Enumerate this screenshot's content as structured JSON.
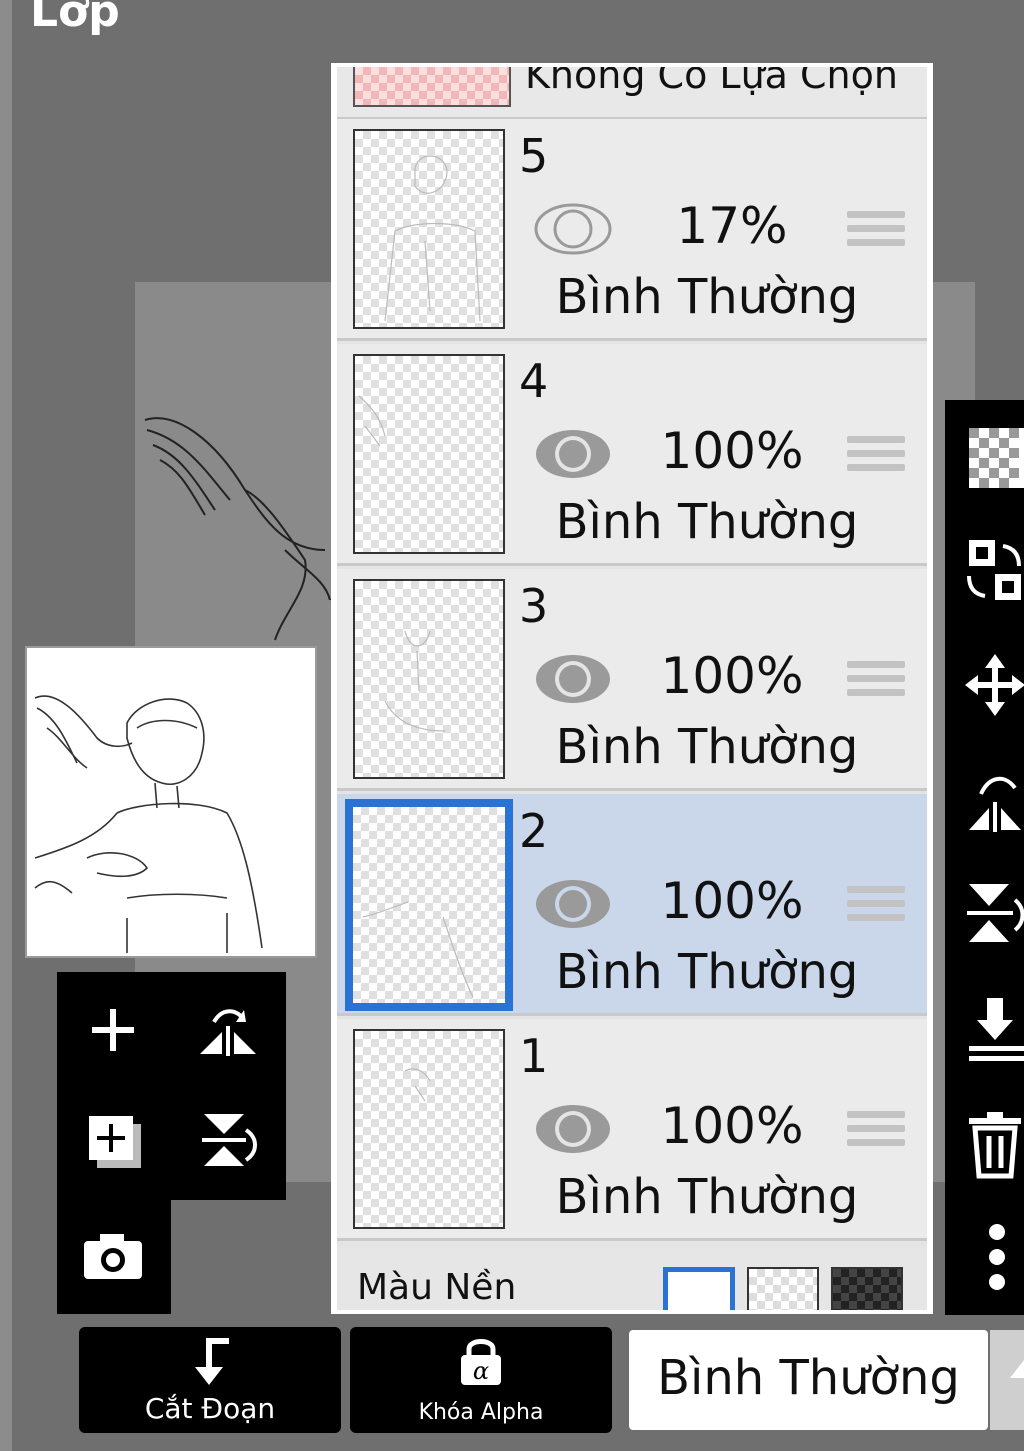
{
  "header": {
    "title": "Lớp"
  },
  "layers_panel": {
    "no_selection_label": "Không Có Lựa Chọn",
    "layers": [
      {
        "number": "5",
        "opacity": "17%",
        "blend_mode": "Bình Thường",
        "selected": false,
        "visible": true
      },
      {
        "number": "4",
        "opacity": "100%",
        "blend_mode": "Bình Thường",
        "selected": false,
        "visible": true
      },
      {
        "number": "3",
        "opacity": "100%",
        "blend_mode": "Bình Thường",
        "selected": false,
        "visible": true
      },
      {
        "number": "2",
        "opacity": "100%",
        "blend_mode": "Bình Thường",
        "selected": true,
        "visible": true
      },
      {
        "number": "1",
        "opacity": "100%",
        "blend_mode": "Bình Thường",
        "selected": false,
        "visible": true
      }
    ],
    "background_label": "Màu Nền"
  },
  "bottom_bar": {
    "clip_label": "Cắt Đoạn",
    "alpha_lock_label": "Khóa Alpha",
    "blend_mode_value": "Bình Thường"
  },
  "colors": {
    "selection_highlight": "#cad7ea",
    "selected_border": "#2a72d4",
    "app_background": "#6f6f6f"
  },
  "icons": {
    "left_tools": [
      "add-layer-icon",
      "flip-horizontal-icon",
      "duplicate-layer-icon",
      "flip-vertical-icon",
      "camera-icon"
    ],
    "right_tools": [
      "transparency-icon",
      "swap-layers-icon",
      "move-icon",
      "flip-horizontal-icon",
      "flip-vertical-icon",
      "merge-down-icon",
      "trash-icon",
      "more-icon"
    ]
  }
}
